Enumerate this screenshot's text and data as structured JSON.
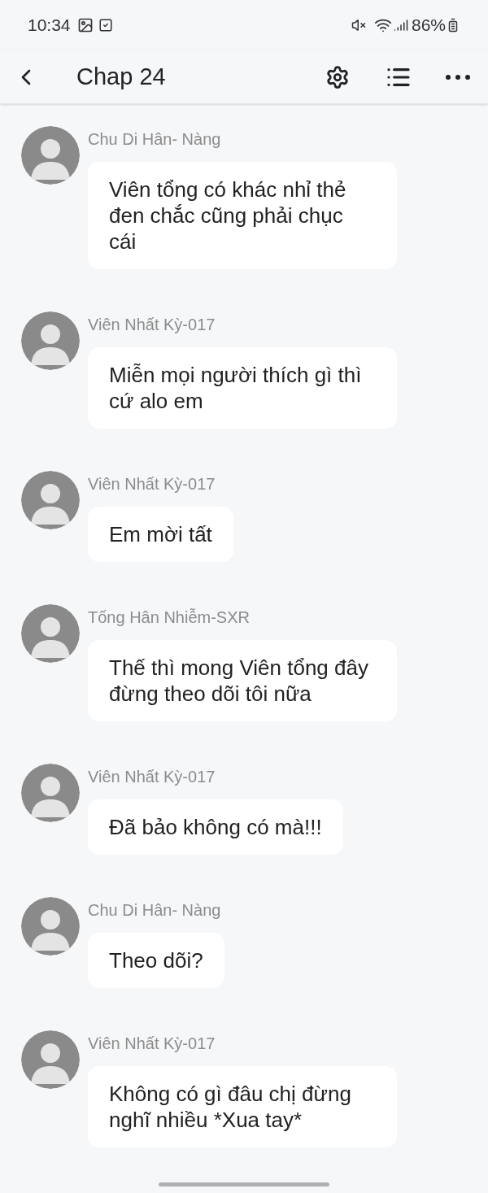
{
  "status_bar": {
    "time": "10:34",
    "battery": "86%"
  },
  "header": {
    "title": "Chap 24"
  },
  "messages": [
    {
      "author": "Chu Di Hân- Nàng",
      "text": "Viên tổng có khác nhỉ thẻ đen chắc cũng phải chục cái"
    },
    {
      "author": "Viên Nhất Kỳ-017",
      "text": "Miễn mọi người thích gì thì cứ alo em"
    },
    {
      "author": "Viên Nhất Kỳ-017",
      "text": "Em mời tất"
    },
    {
      "author": "Tống Hân Nhiễm-SXR",
      "text": "Thế thì mong Viên tổng đây đừng theo dõi tôi nữa"
    },
    {
      "author": "Viên Nhất Kỳ-017",
      "text": "Đã bảo không có mà!!!"
    },
    {
      "author": "Chu Di Hân- Nàng",
      "text": "Theo dõi?"
    },
    {
      "author": "Viên Nhất Kỳ-017",
      "text": "Không có gì đâu chị đừng nghĩ nhiều *Xua tay*"
    }
  ]
}
